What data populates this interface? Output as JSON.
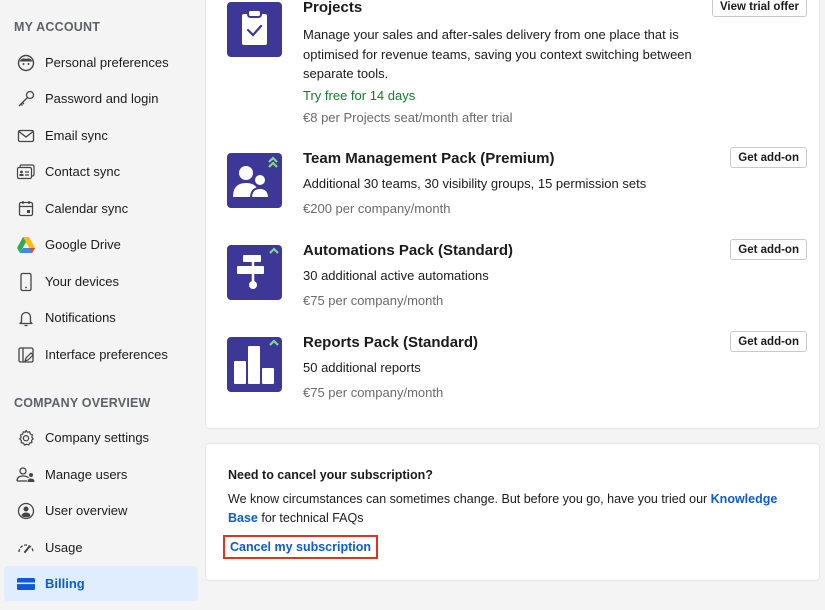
{
  "sidebar": {
    "sections": [
      {
        "title": "MY ACCOUNT",
        "items": [
          {
            "label": "Personal preferences",
            "icon": "face-icon"
          },
          {
            "label": "Password and login",
            "icon": "key-icon"
          },
          {
            "label": "Email sync",
            "icon": "envelope-icon"
          },
          {
            "label": "Contact sync",
            "icon": "contact-card-icon"
          },
          {
            "label": "Calendar sync",
            "icon": "calendar-icon"
          },
          {
            "label": "Google Drive",
            "icon": "google-drive-icon"
          },
          {
            "label": "Your devices",
            "icon": "phone-icon"
          },
          {
            "label": "Notifications",
            "icon": "bell-icon"
          },
          {
            "label": "Interface preferences",
            "icon": "interface-edit-icon"
          }
        ]
      },
      {
        "title": "COMPANY OVERVIEW",
        "items": [
          {
            "label": "Company settings",
            "icon": "gear-icon"
          },
          {
            "label": "Manage users",
            "icon": "users-icon"
          },
          {
            "label": "User overview",
            "icon": "user-circle-icon"
          },
          {
            "label": "Usage",
            "icon": "gauge-icon"
          },
          {
            "label": "Billing",
            "icon": "credit-card-icon",
            "active": true
          }
        ]
      }
    ]
  },
  "addons": [
    {
      "title": "Projects",
      "description": "Manage your sales and after-sales delivery from one place that is optimised for revenue teams, saving you context switching between separate tools.",
      "trial": "Try free for 14 days",
      "price": "€8 per Projects seat/month after trial",
      "button": "View trial offer",
      "icon": "clipboard-check-icon"
    },
    {
      "title": "Team Management Pack (Premium)",
      "description": "Additional 30 teams, 30 visibility groups, 15 permission sets",
      "price": "€200 per company/month",
      "button": "Get add-on",
      "icon": "team-icon"
    },
    {
      "title": "Automations Pack (Standard)",
      "description": "30 additional active automations",
      "price": "€75 per company/month",
      "button": "Get add-on",
      "icon": "workflow-icon"
    },
    {
      "title": "Reports Pack (Standard)",
      "description": "50 additional reports",
      "price": "€75 per company/month",
      "button": "Get add-on",
      "icon": "bar-chart-icon"
    }
  ],
  "cancel": {
    "title": "Need to cancel your subscription?",
    "text_before": "We know circumstances can sometimes change. But before you go, have you tried our ",
    "link": "Knowledge Base",
    "text_after": " for technical FAQs",
    "cancel_link": "Cancel my subscription"
  },
  "colors": {
    "accent": "#0d5bd7",
    "icon_bg": "#3d3897",
    "upgrade_chevron": "#7fd98a",
    "trial_green": "#157a2c",
    "highlight_border": "#e4321b",
    "active_bg": "#dfedfe"
  }
}
